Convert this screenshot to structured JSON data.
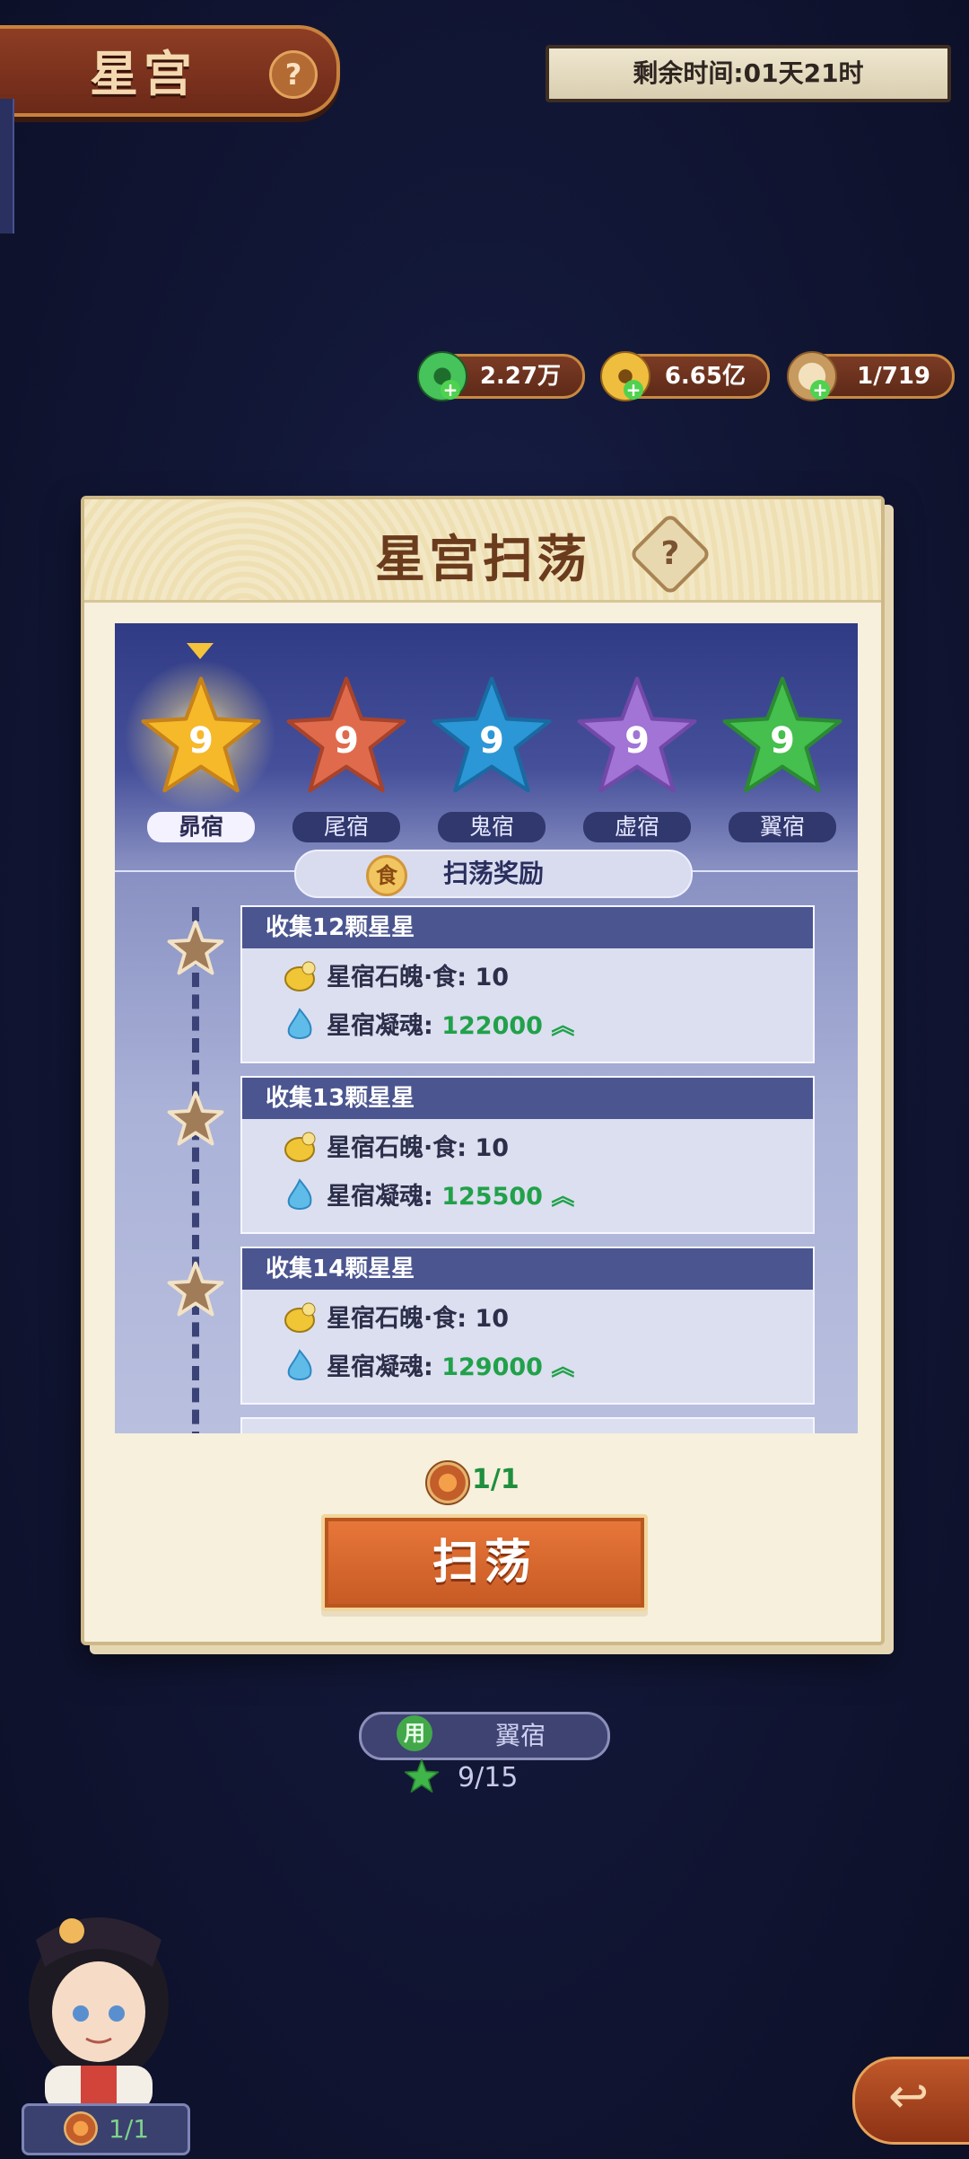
{
  "header": {
    "title": "星宫",
    "help_icon": "question-icon",
    "timer_text": "剩余时间:01天21时"
  },
  "currencies": [
    {
      "name": "jade",
      "icon": "jade-coin-icon",
      "value": "2.27万",
      "color": "#39b34a"
    },
    {
      "name": "copper",
      "icon": "copper-coin-icon",
      "value": "6.65亿",
      "color": "#e0a72b"
    },
    {
      "name": "stamina",
      "icon": "character-scroll-icon",
      "value": "1/719",
      "color": "#cfa46e"
    }
  ],
  "panel": {
    "title": "星宫扫荡",
    "mansions": [
      {
        "label": "昴宿",
        "stars": "9",
        "color": "#f5b92a",
        "selected": true
      },
      {
        "label": "尾宿",
        "stars": "9",
        "color": "#e06b4c",
        "selected": false
      },
      {
        "label": "鬼宿",
        "stars": "9",
        "color": "#2c97d6",
        "selected": false
      },
      {
        "label": "虚宿",
        "stars": "9",
        "color": "#a174d6",
        "selected": false
      },
      {
        "label": "翼宿",
        "stars": "9",
        "color": "#45bf4d",
        "selected": false
      }
    ],
    "reward_badge": "食",
    "reward_title": "扫荡奖励",
    "tiers": [
      {
        "title": "收集12颗星星",
        "item1": "星宿石魄·食: 10",
        "item2_label": "星宿凝魂:",
        "item2_value": "122000",
        "arrow": "︽"
      },
      {
        "title": "收集13颗星星",
        "item1": "星宿石魄·食: 10",
        "item2_label": "星宿凝魂:",
        "item2_value": "125500",
        "arrow": "︽"
      },
      {
        "title": "收集14颗星星",
        "item1": "星宿石魄·食: 10",
        "item2_label": "星宿凝魂:",
        "item2_value": "129000",
        "arrow": "︽"
      }
    ],
    "cost_text": "1/1",
    "sweep_button": "扫荡"
  },
  "current": {
    "use_badge": "用",
    "mansion": "翼宿",
    "progress": "9/15"
  },
  "character": {
    "cost_text": "1/1"
  },
  "back_icon": "back-arrow-icon"
}
